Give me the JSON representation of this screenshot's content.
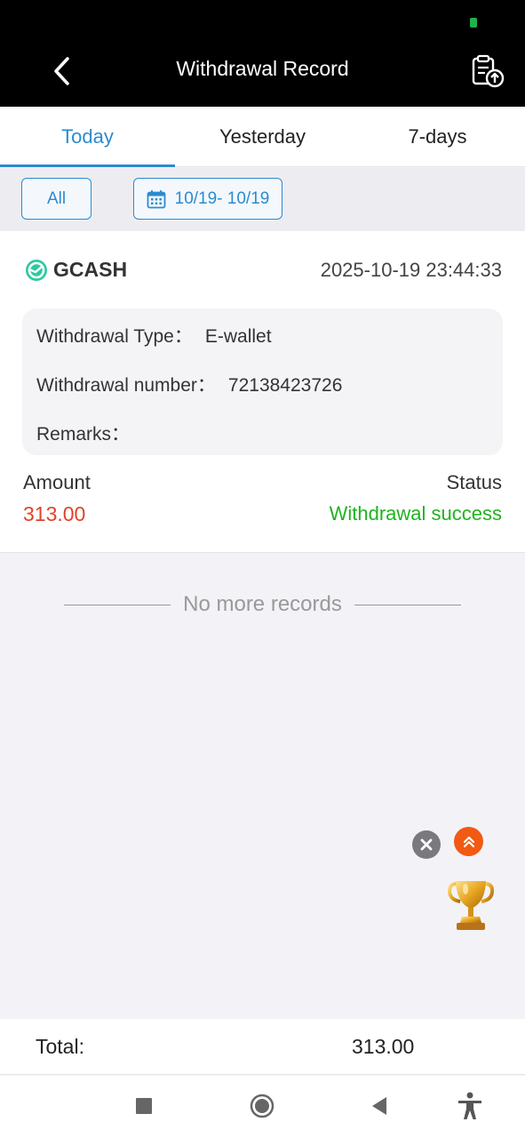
{
  "header": {
    "title": "Withdrawal Record",
    "back_icon": "chevron-left-icon",
    "upload_icon": "clipboard-upload-icon"
  },
  "tabs": [
    {
      "label": "Today",
      "active": true
    },
    {
      "label": "Yesterday",
      "active": false
    },
    {
      "label": "7-days",
      "active": false
    }
  ],
  "filters": {
    "all_label": "All",
    "date_range": "10/19- 10/19",
    "calendar_icon": "calendar-icon"
  },
  "record": {
    "brand": "GCASH",
    "datetime": "2025-10-19 23:44:33",
    "withdrawal_type_label": "Withdrawal Type：",
    "withdrawal_type_value": "E-wallet",
    "withdrawal_number_label": "Withdrawal number：",
    "withdrawal_number_value": "72138423726",
    "remarks_label": "Remarks：",
    "remarks_value": "",
    "amount_label": "Amount",
    "amount_value": "313.00",
    "status_label": "Status",
    "status_value": "Withdrawal success"
  },
  "list_end_text": "No more records",
  "footer": {
    "total_label": "Total:",
    "total_value": "313.00"
  },
  "colors": {
    "accent": "#2b8bd0",
    "amount": "#e0432a",
    "success": "#1fb31f",
    "header_bg": "#000000"
  }
}
